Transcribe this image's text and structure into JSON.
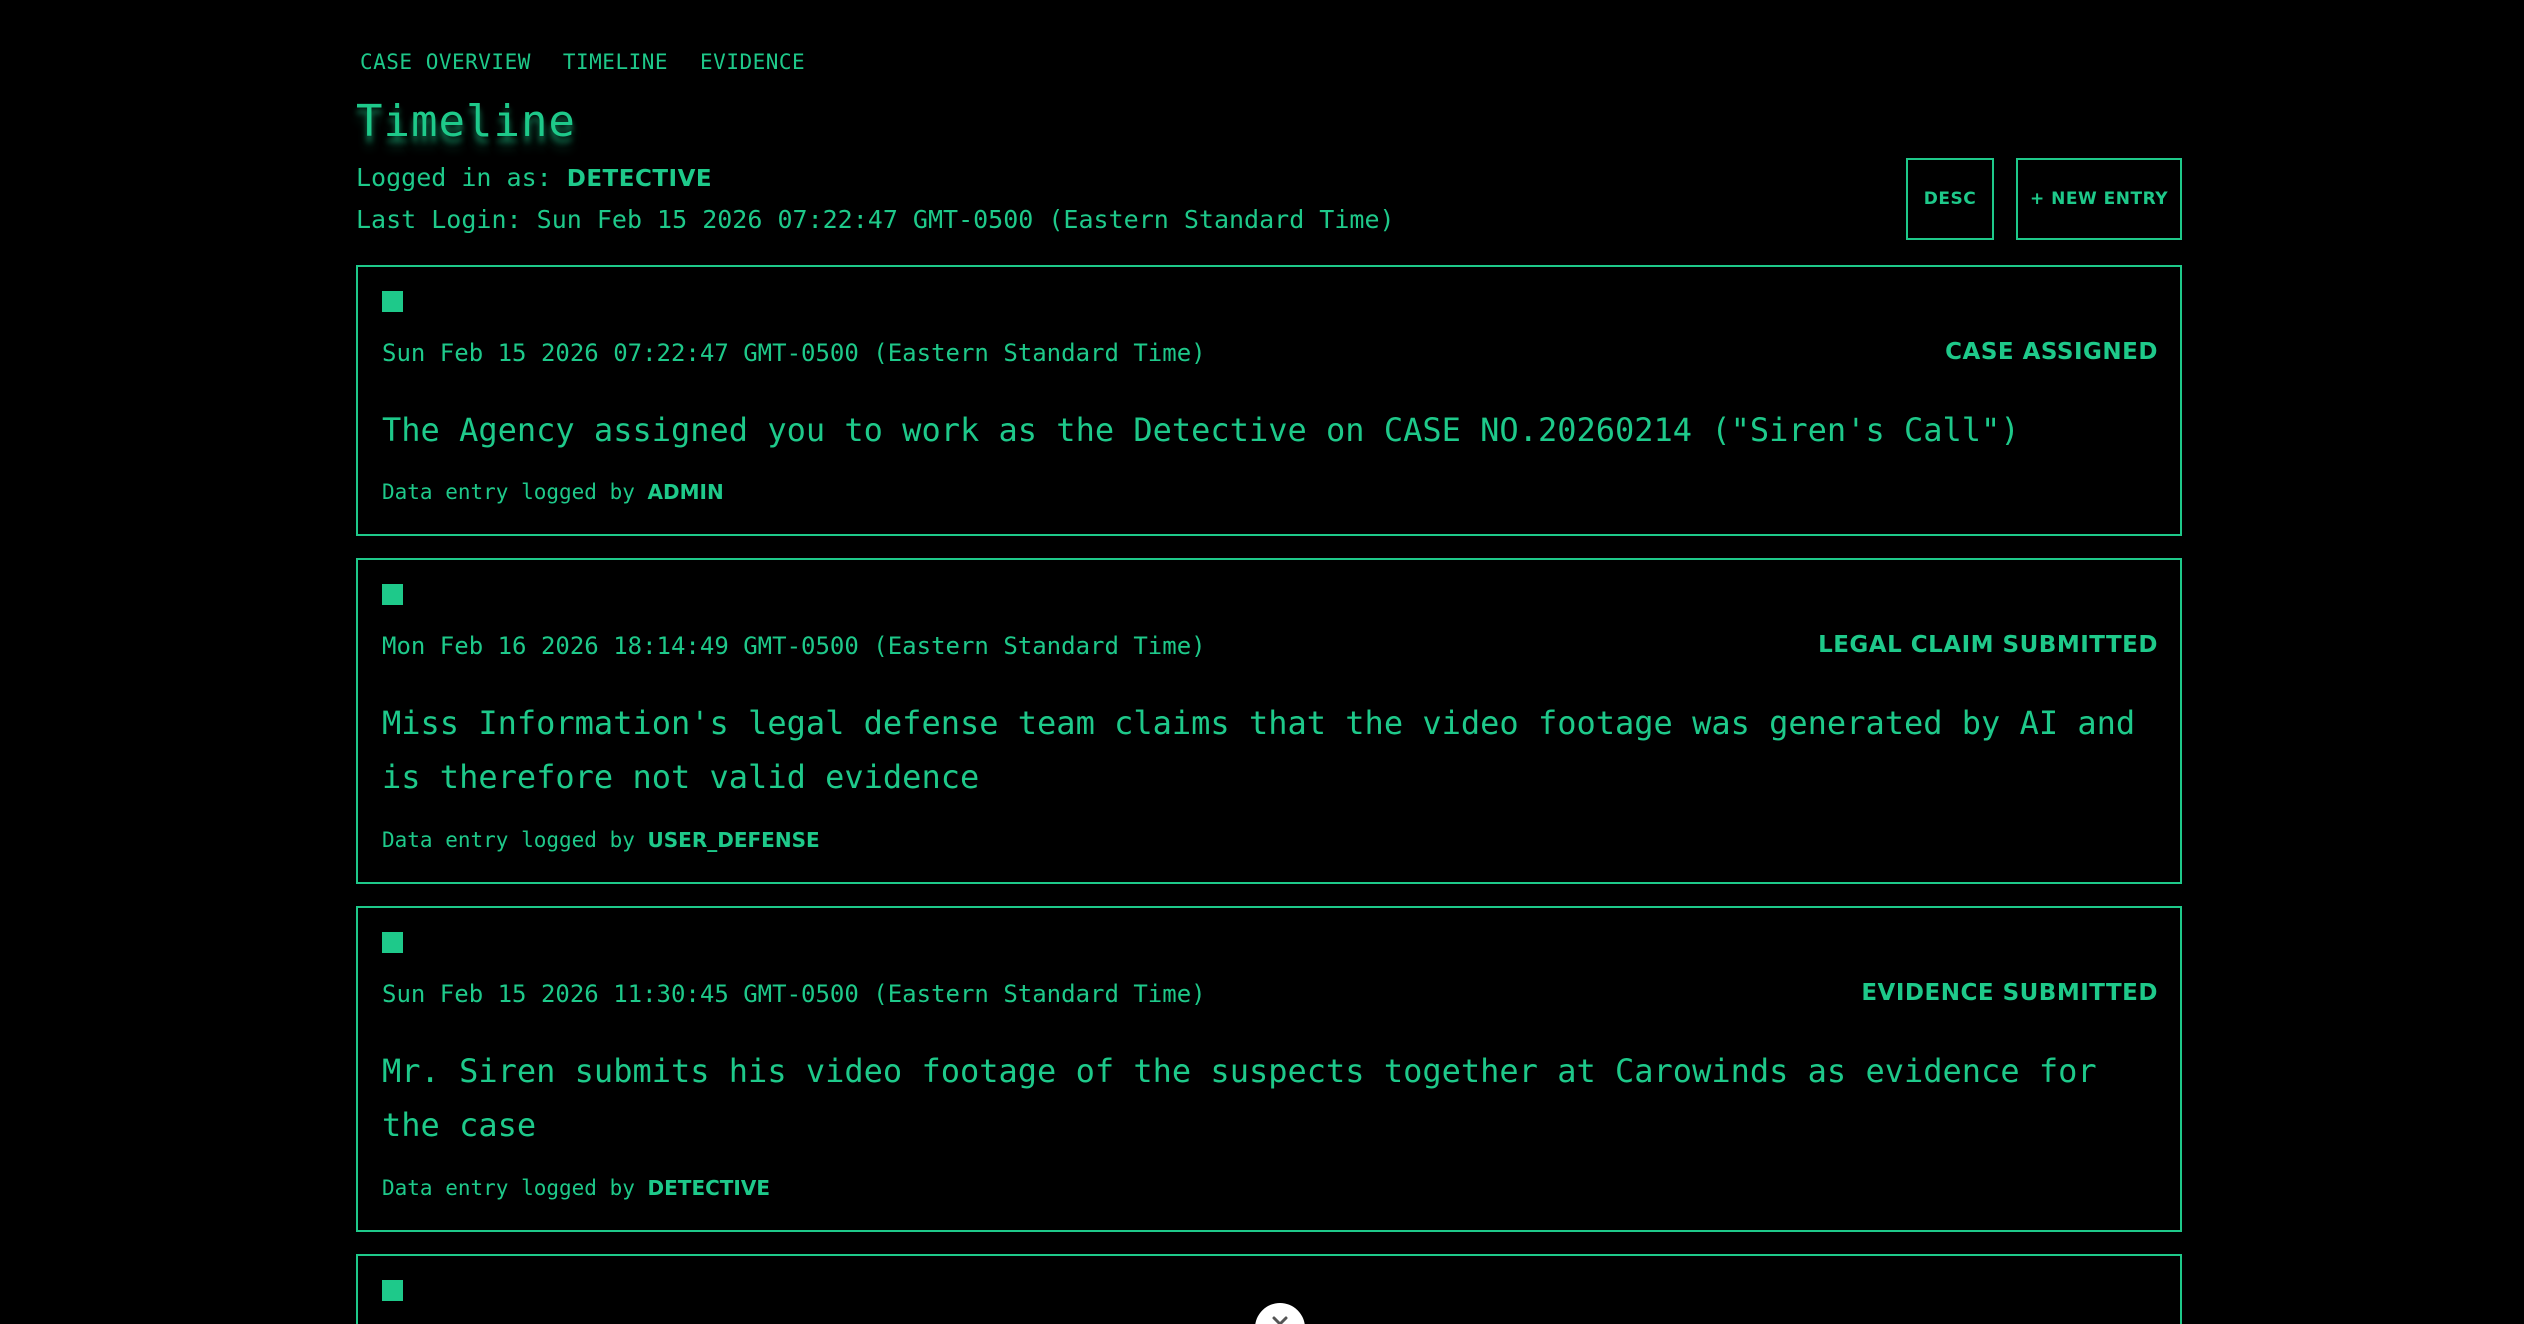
{
  "nav": {
    "items": [
      {
        "label": "CASE OVERVIEW"
      },
      {
        "label": "TIMELINE"
      },
      {
        "label": "EVIDENCE"
      }
    ]
  },
  "page": {
    "title": "Timeline"
  },
  "session": {
    "logged_in_prefix": "Logged in as:",
    "user": "DETECTIVE",
    "last_login_prefix": "Last Login:",
    "last_login": "Sun Feb 15 2026 07:22:47 GMT-0500 (Eastern Standard Time)"
  },
  "toolbar": {
    "sort_label": "DESC",
    "new_entry_label": "+ NEW ENTRY"
  },
  "entries": [
    {
      "timestamp": "Sun Feb 15 2026 07:22:47 GMT-0500 (Eastern Standard Time)",
      "type": "CASE ASSIGNED",
      "description": "The Agency assigned you to work as the Detective on CASE NO.20260214 (\"Siren's Call\")",
      "logged_prefix": "Data entry logged by",
      "logged_by": "ADMIN"
    },
    {
      "timestamp": "Mon Feb 16 2026 18:14:49 GMT-0500 (Eastern Standard Time)",
      "type": "LEGAL CLAIM SUBMITTED",
      "description": "Miss Information's legal defense team claims that the video footage was generated by AI and is therefore not valid evidence",
      "logged_prefix": "Data entry logged by",
      "logged_by": "USER_DEFENSE"
    },
    {
      "timestamp": "Sun Feb 15 2026 11:30:45 GMT-0500 (Eastern Standard Time)",
      "type": "EVIDENCE SUBMITTED",
      "description": "Mr. Siren submits his video footage of the suspects together at Carowinds as evidence for the case",
      "logged_prefix": "Data entry logged by",
      "logged_by": "DETECTIVE"
    }
  ],
  "icons": {
    "entry_marker": "square-marker-icon",
    "floating_close": "close-icon"
  },
  "colors": {
    "background": "#000000",
    "accent": "#1ec98a"
  }
}
